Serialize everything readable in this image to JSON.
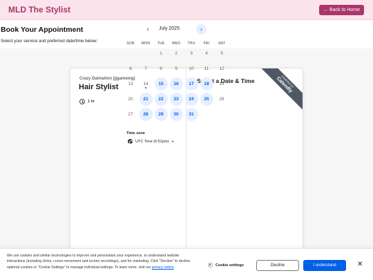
{
  "header": {
    "brand": "MLD The Stylist",
    "back_label": "← Back to Home"
  },
  "page": {
    "title": "Book Your Appointment",
    "subtitle": "Select your service and preferred date/time below:"
  },
  "event": {
    "organizer": "Crazy Dalmation (jjgameing)",
    "name": "Hair Stylist",
    "duration": "1 hr"
  },
  "calendar": {
    "title": "Select a Date & Time",
    "month": "July 2025",
    "prev_icon": "‹",
    "next_icon": "›",
    "weekdays": [
      "SUN",
      "MON",
      "TUE",
      "WED",
      "THU",
      "FRI",
      "SAT"
    ],
    "days": [
      {
        "label": "1",
        "col": 2,
        "row": 0,
        "available": false
      },
      {
        "label": "2",
        "col": 3,
        "row": 0,
        "available": false
      },
      {
        "label": "3",
        "col": 4,
        "row": 0,
        "available": false
      },
      {
        "label": "4",
        "col": 5,
        "row": 0,
        "available": false
      },
      {
        "label": "5",
        "col": 6,
        "row": 0,
        "available": false
      },
      {
        "label": "6",
        "col": 0,
        "row": 1,
        "available": false
      },
      {
        "label": "7",
        "col": 1,
        "row": 1,
        "available": false
      },
      {
        "label": "8",
        "col": 2,
        "row": 1,
        "available": false
      },
      {
        "label": "9",
        "col": 3,
        "row": 1,
        "available": false
      },
      {
        "label": "10",
        "col": 4,
        "row": 1,
        "available": false
      },
      {
        "label": "11",
        "col": 5,
        "row": 1,
        "available": false
      },
      {
        "label": "12",
        "col": 6,
        "row": 1,
        "available": false
      },
      {
        "label": "13",
        "col": 0,
        "row": 2,
        "available": false
      },
      {
        "label": "14",
        "col": 1,
        "row": 2,
        "available": false,
        "today": true
      },
      {
        "label": "15",
        "col": 2,
        "row": 2,
        "available": true
      },
      {
        "label": "16",
        "col": 3,
        "row": 2,
        "available": true
      },
      {
        "label": "17",
        "col": 4,
        "row": 2,
        "available": true
      },
      {
        "label": "18",
        "col": 5,
        "row": 2,
        "available": true
      },
      {
        "label": "19",
        "col": 6,
        "row": 2,
        "available": false
      },
      {
        "label": "20",
        "col": 0,
        "row": 3,
        "available": false
      },
      {
        "label": "21",
        "col": 1,
        "row": 3,
        "available": true
      },
      {
        "label": "22",
        "col": 2,
        "row": 3,
        "available": true
      },
      {
        "label": "23",
        "col": 3,
        "row": 3,
        "available": true
      },
      {
        "label": "24",
        "col": 4,
        "row": 3,
        "available": true
      },
      {
        "label": "25",
        "col": 5,
        "row": 3,
        "available": true
      },
      {
        "label": "26",
        "col": 6,
        "row": 3,
        "available": false
      },
      {
        "label": "27",
        "col": 0,
        "row": 4,
        "available": false
      },
      {
        "label": "28",
        "col": 1,
        "row": 4,
        "available": true
      },
      {
        "label": "29",
        "col": 2,
        "row": 4,
        "available": true
      },
      {
        "label": "30",
        "col": 3,
        "row": 4,
        "available": true
      },
      {
        "label": "31",
        "col": 4,
        "row": 4,
        "available": true
      }
    ],
    "timezone_label": "Time zone",
    "timezone_value": "UTC Time (6:51pm)"
  },
  "badge": {
    "small": "POWERED BY",
    "big": "Calendly"
  },
  "cookie": {
    "text": "We use cookies and similar technologies to improve and personalize your experience, to understand website interactions (including clicks, cursor movement and screen recordings), and for marketing. Click \"Decline\" to decline optional cookies or \"Cookie Settings\" to manage individual settings. To learn more, visit our ",
    "link": "privacy notice",
    "link_suffix": ".",
    "settings_label": "Cookie settings",
    "decline_label": "Decline",
    "accept_label": "I understand",
    "close_icon": "✕"
  },
  "colors": {
    "brand": "#a8376a",
    "header_bg": "#fbe4ec",
    "accent": "#0060e6",
    "available_bg": "#e6efff"
  }
}
